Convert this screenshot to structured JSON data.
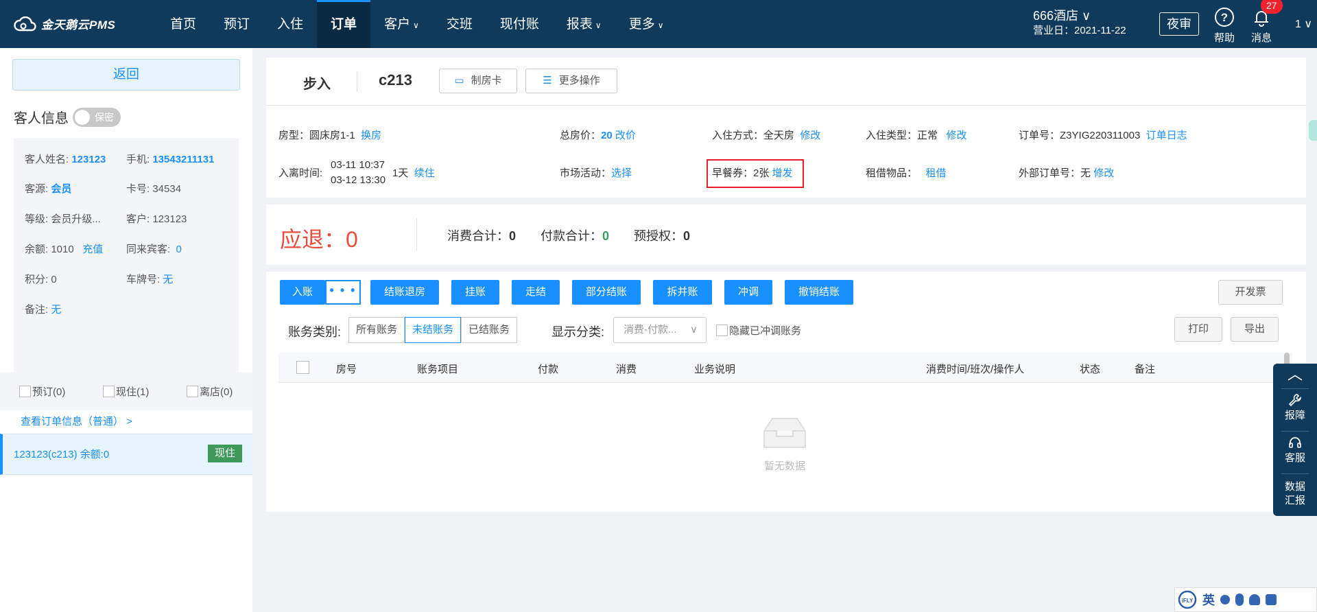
{
  "app": {
    "logo_text": "金天鹅云PMS",
    "nav": [
      {
        "label": "首页",
        "caret": ""
      },
      {
        "label": "预订",
        "caret": ""
      },
      {
        "label": "入住",
        "caret": ""
      },
      {
        "label": "订单",
        "caret": ""
      },
      {
        "label": "客户",
        "caret": "∨"
      },
      {
        "label": "交班",
        "caret": ""
      },
      {
        "label": "现付账",
        "caret": ""
      },
      {
        "label": "报表",
        "caret": "∨"
      },
      {
        "label": "更多",
        "caret": "∨"
      }
    ],
    "active_nav": "订单",
    "hotel_name": "666酒店 ∨",
    "business_date": "营业日：2021-11-22",
    "night_audit": "夜审",
    "help": "帮助",
    "messages": "消息",
    "message_count": "27",
    "user": "1 ∨"
  },
  "left": {
    "back": "返回",
    "guest_info_title": "客人信息",
    "privacy_toggle": "保密",
    "fields": {
      "name_label": "客人姓名:",
      "name": "123123",
      "phone_label": "手机:",
      "phone": "13543211131",
      "source_label": "客源:",
      "source": "会员",
      "card_label": "卡号:",
      "card": "34534",
      "level_label": "等级:",
      "level": "会员升级...",
      "customer_label": "客户:",
      "customer": "123123",
      "balance_label": "余额:",
      "balance": "1010",
      "recharge": "充值",
      "companions_label": "同来宾客:",
      "companions": "0",
      "points_label": "积分:",
      "points": "0",
      "plate_label": "车牌号:",
      "plate": "无",
      "note_label": "备注:",
      "note": "无"
    },
    "filters": [
      "预订(0)",
      "现住(1)",
      "离店(0)"
    ],
    "view_order": "查看订单信息（普通）  >",
    "room_item": {
      "text": "123123(c213)    余额:0",
      "status": "现住"
    }
  },
  "order": {
    "type": "步入",
    "room": "c213",
    "make_card": "制房卡",
    "more_ops": "更多操作",
    "room_type_label": "房型：",
    "room_type": "圆床房1-1",
    "change_room": "换房",
    "total_price_label": "总房价：",
    "total_price": "20",
    "change_price": "改价",
    "checkin_mode_label": "入住方式：",
    "checkin_mode": "全天房",
    "modify": "修改",
    "checkin_type_label": "入住类型：",
    "checkin_type": "正常",
    "order_no_label": "订单号：",
    "order_no": "Z3YIG220311003",
    "order_log": "订单日志",
    "stay_label": "入离时间:",
    "arrive": "03-11 10:37",
    "depart": "03-12 13:30",
    "nights": "1天",
    "extend": "续住",
    "market_label": "市场活动：",
    "market_select": "选择",
    "breakfast_label": "早餐券：",
    "breakfast": "2张",
    "breakfast_add": "增发",
    "rental_label": "租借物品：",
    "rental": "租借",
    "external_label": "外部订单号：",
    "external": "无"
  },
  "summary": {
    "refund_label": "应退：",
    "refund": "0",
    "consume_label": "消费合计：",
    "consume": "0",
    "pay_label": "付款合计：",
    "pay": "0",
    "preauth_label": "预授权：",
    "preauth": "0"
  },
  "billing": {
    "actions": [
      "入账",
      "结账退房",
      "挂账",
      "走结",
      "部分结账",
      "拆并账",
      "冲调",
      "撤销结账"
    ],
    "more": "• • •",
    "invoice": "开发票",
    "category_label": "账务类别:",
    "categories": [
      "所有账务",
      "未结账务",
      "已结账务"
    ],
    "display_label": "显示分类:",
    "display_value": "消费-付款...",
    "hide_reversed": "隐藏已冲调账务",
    "print": "打印",
    "export": "导出",
    "columns": [
      "房号",
      "账务项目",
      "付款",
      "消费",
      "业务说明",
      "消费时间/班次/操作人",
      "状态",
      "备注"
    ],
    "empty": "暂无数据"
  },
  "sidebar": {
    "report_issue": "报障",
    "service": "客服",
    "data_report_1": "数据",
    "data_report_2": "汇报"
  },
  "ime": {
    "lang": "英"
  }
}
